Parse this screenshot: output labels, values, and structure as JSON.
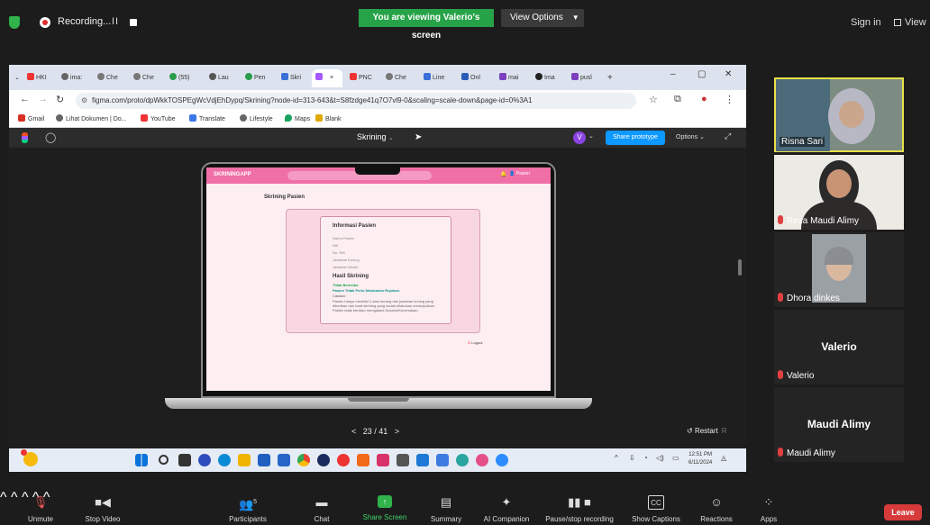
{
  "zoom_top": {
    "recording_label": "Recording...",
    "pause_glyph": "II",
    "viewing_banner": "You are viewing Valerio's screen",
    "view_options": "View Options",
    "sign_in": "Sign in",
    "view": "View"
  },
  "browser": {
    "tabs": [
      "HKI",
      "ima:",
      "Che",
      "Che",
      "(55)",
      "Lau",
      "Pen",
      "Skri",
      "",
      "PNC",
      "Che",
      "Line",
      "Onl",
      "mai",
      "Ima",
      "pusl"
    ],
    "active_tab_close": "×",
    "new_tab": "+",
    "url": "figma.com/proto/dpWkkTOSPEgWcVdjEhDypq/Skrining?node-id=313-643&t=S8fzdge41q7O7vl9-0&scaling=scale-down&page-id=0%3A1",
    "bookmarks": [
      "Gmail",
      "Lihat Dokumen | Do...",
      "YouTube",
      "Translate",
      "Lifestyle",
      "Maps",
      "Blank"
    ]
  },
  "figma": {
    "title": "Skrining",
    "avatar_letter": "V",
    "share_button": "Share prototype",
    "options": "Options",
    "pager": "23 / 41",
    "restart": "Restart",
    "restart_key": "R"
  },
  "app": {
    "brand": "SKRININGAPP",
    "user": "Pasien",
    "page_title": "Skrining Pasien",
    "info_title": "Informasi Pasien",
    "fields": [
      "Nama Pasien",
      "NIK",
      "No. RM",
      "Jawaban Kuning",
      "Jawaban Merah"
    ],
    "result_title": "Hasil Skrining",
    "result_status": "Tidak Beresiko",
    "result_line": "Pasien Tidak Perlu Melakukan Rujukan.",
    "note_label": "Catatan :",
    "note_text": "Pasien hanya memiliki 1 atau kurang dari jawaban kuning yang diberikan dan hasil skrining yang sudah dilakukan menunjukkan Pasien tidak berisiko mengalami Depresi/Kecemasan.",
    "logout": "Logout"
  },
  "taskbar": {
    "time": "12:51 PM",
    "date": "6/11/2024"
  },
  "participants": [
    {
      "name": "Risna Sari"
    },
    {
      "name": "Reza Maudi Alimy"
    },
    {
      "name": "Dhora dinkes"
    },
    {
      "name": "Valerio",
      "display": "Valerio"
    },
    {
      "name": "Maudi Alimy",
      "display": "Maudi Alimy"
    }
  ],
  "toolbar": {
    "unmute": "Unmute",
    "stop_video": "Stop Video",
    "participants": "Participants",
    "participant_count": "5",
    "chat": "Chat",
    "share_screen": "Share Screen",
    "summary": "Summary",
    "ai_companion": "AI Companion",
    "pause_recording": "Pause/stop recording",
    "show_captions": "Show Captions",
    "cc": "CC",
    "reactions": "Reactions",
    "apps": "Apps",
    "leave": "Leave"
  },
  "colors": {
    "banner_green": "#26a248",
    "figma_blue": "#0d99ff",
    "app_pink": "#f06fa7",
    "leave_red": "#d73a3a"
  }
}
